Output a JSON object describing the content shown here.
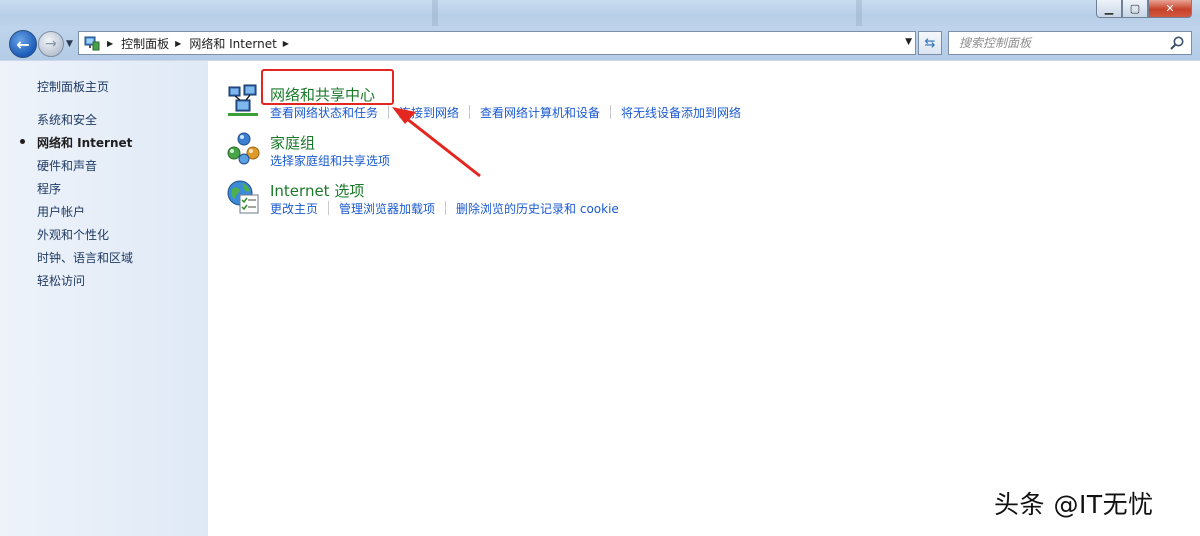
{
  "window": {
    "controls": {
      "minimize": "▁",
      "maximize": "▢",
      "close": "✕"
    }
  },
  "navigation": {
    "back_icon": "back-arrow-icon",
    "forward_icon": "forward-arrow-icon",
    "breadcrumbs": [
      "控制面板",
      "网络和 Internet"
    ],
    "search_placeholder": "搜索控制面板"
  },
  "sidebar": {
    "items": [
      {
        "label": "控制面板主页",
        "active": false
      },
      {
        "label": "系统和安全",
        "active": false
      },
      {
        "label": "网络和 Internet",
        "active": true
      },
      {
        "label": "硬件和声音",
        "active": false
      },
      {
        "label": "程序",
        "active": false
      },
      {
        "label": "用户帐户",
        "active": false
      },
      {
        "label": "外观和个性化",
        "active": false
      },
      {
        "label": "时钟、语言和区域",
        "active": false
      },
      {
        "label": "轻松访问",
        "active": false
      }
    ]
  },
  "categories": [
    {
      "title": "网络和共享中心",
      "icon": "network-center-icon",
      "links": [
        "查看网络状态和任务",
        "连接到网络",
        "查看网络计算机和设备",
        "将无线设备添加到网络"
      ]
    },
    {
      "title": "家庭组",
      "icon": "homegroup-icon",
      "links": [
        "选择家庭组和共享选项"
      ]
    },
    {
      "title": "Internet 选项",
      "icon": "internet-options-icon",
      "links": [
        "更改主页",
        "管理浏览器加载项",
        "删除浏览的历史记录和 cookie"
      ]
    }
  ],
  "annotation": {
    "color": "#e3261f"
  },
  "watermark": "头条 @IT无忧",
  "colors": {
    "title_green": "#1b7a2a",
    "link_blue": "#1a5ad1"
  }
}
